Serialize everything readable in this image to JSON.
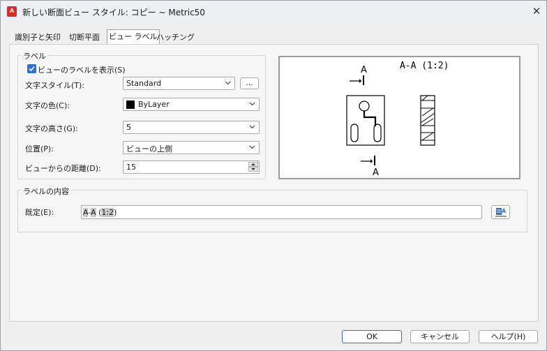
{
  "window": {
    "title": "新しい断面ビュー スタイル: コピー ~ Metric50",
    "app_icon_letter": "A",
    "close_glyph": "✕"
  },
  "tabs": [
    {
      "label": "識別子と矢印"
    },
    {
      "label": "切断平面"
    },
    {
      "label": "ビュー ラベル"
    },
    {
      "label": "ハッチング"
    }
  ],
  "label_group": {
    "title": "ラベル",
    "show_label": {
      "text": "ビューのラベルを表示(S)",
      "checked": true
    },
    "text_style": {
      "label": "文字スタイル(T):",
      "value": "Standard",
      "browse_label": "..."
    },
    "text_color": {
      "label": "文字の色(C):",
      "value": "ByLayer",
      "swatch_color": "#000000"
    },
    "text_height": {
      "label": "文字の高さ(G):",
      "value": "5"
    },
    "position": {
      "label": "位置(P):",
      "value": "ビューの上側"
    },
    "distance": {
      "label": "ビューからの距離(D):",
      "value": "15"
    }
  },
  "preview": {
    "title": "A-A (1:2)",
    "top_marker": "A",
    "bottom_marker": "A"
  },
  "content_group": {
    "title": "ラベルの内容",
    "default_label": "既定(E):",
    "default_value": "A-A (1:2)"
  },
  "footer": {
    "ok": "OK",
    "cancel": "キャンセル",
    "help": "ヘルプ(H)"
  }
}
